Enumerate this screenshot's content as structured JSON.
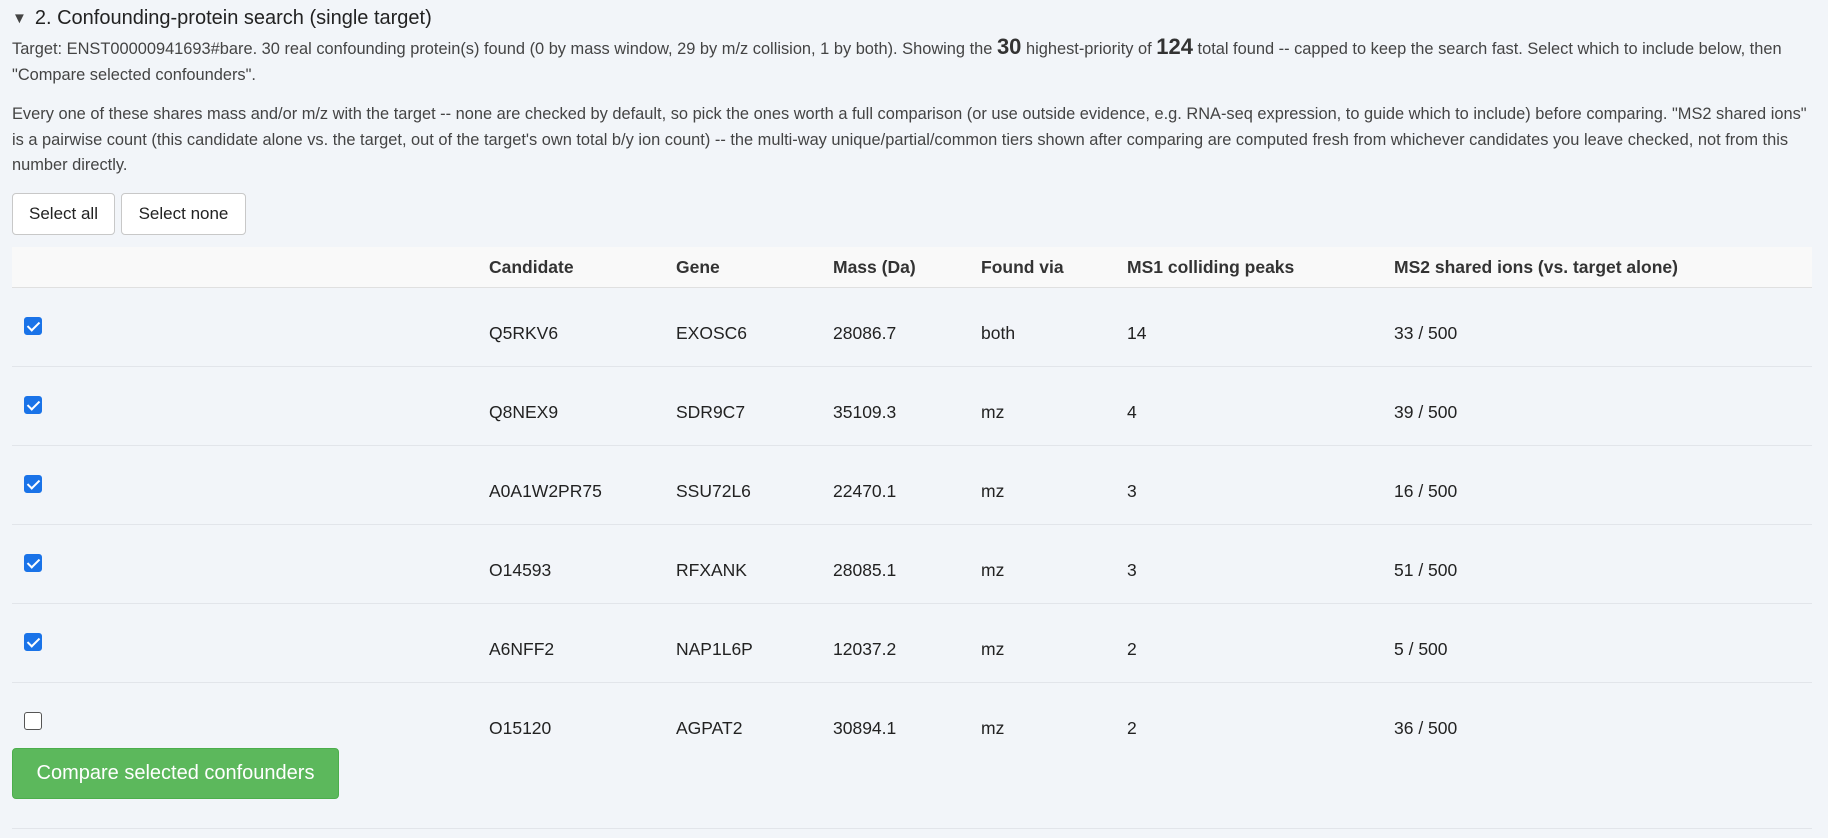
{
  "section": {
    "caret": "▼",
    "title": "2. Confounding-protein search (single target)",
    "desc1": {
      "part1": "Target: ENST00000941693#bare. 30 real confounding protein(s) found (0 by mass window, 29 by m/z collision, 1 by both). Showing the ",
      "shown": "30",
      "part2": " highest-priority of ",
      "total": "124",
      "part3": " total found -- capped to keep the search fast. Select which to include below, then \"Compare selected confounders\"."
    },
    "desc2": "Every one of these shares mass and/or m/z with the target -- none are checked by default, so pick the ones worth a full comparison (or use outside evidence, e.g. RNA-seq expression, to guide which to include) before comparing. \"MS2 shared ions\" is a pairwise count (this candidate alone vs. the target, out of the target's own total b/y ion count) -- the multi-way unique/partial/common tiers shown after comparing are computed fresh from whichever candidates you leave checked, not from this number directly.",
    "select_all": "Select all",
    "select_none": "Select none",
    "compare_button": "Compare selected confounders"
  },
  "table": {
    "headers": {
      "candidate": "Candidate",
      "gene": "Gene",
      "mass": "Mass (Da)",
      "via": "Found via",
      "ms1": "MS1 colliding peaks",
      "ms2": "MS2 shared ions (vs. target alone)"
    },
    "rows": [
      {
        "checked": true,
        "candidate": "Q5RKV6",
        "gene": "EXOSC6",
        "mass": "28086.7",
        "via": "both",
        "ms1": "14",
        "ms2": "33 / 500"
      },
      {
        "checked": true,
        "candidate": "Q8NEX9",
        "gene": "SDR9C7",
        "mass": "35109.3",
        "via": "mz",
        "ms1": "4",
        "ms2": "39 / 500"
      },
      {
        "checked": true,
        "candidate": "A0A1W2PR75",
        "gene": "SSU72L6",
        "mass": "22470.1",
        "via": "mz",
        "ms1": "3",
        "ms2": "16 / 500"
      },
      {
        "checked": true,
        "candidate": "O14593",
        "gene": "RFXANK",
        "mass": "28085.1",
        "via": "mz",
        "ms1": "3",
        "ms2": "51 / 500"
      },
      {
        "checked": true,
        "candidate": "A6NFF2",
        "gene": "NAP1L6P",
        "mass": "12037.2",
        "via": "mz",
        "ms1": "2",
        "ms2": "5 / 500"
      },
      {
        "checked": false,
        "candidate": "O15120",
        "gene": "AGPAT2",
        "mass": "30894.1",
        "via": "mz",
        "ms1": "2",
        "ms2": "36 / 500"
      }
    ]
  },
  "colors": {
    "checkbox_on": "#1a73e8",
    "compare_button": "#5cb85c",
    "page_background": "#f2f5f9"
  }
}
